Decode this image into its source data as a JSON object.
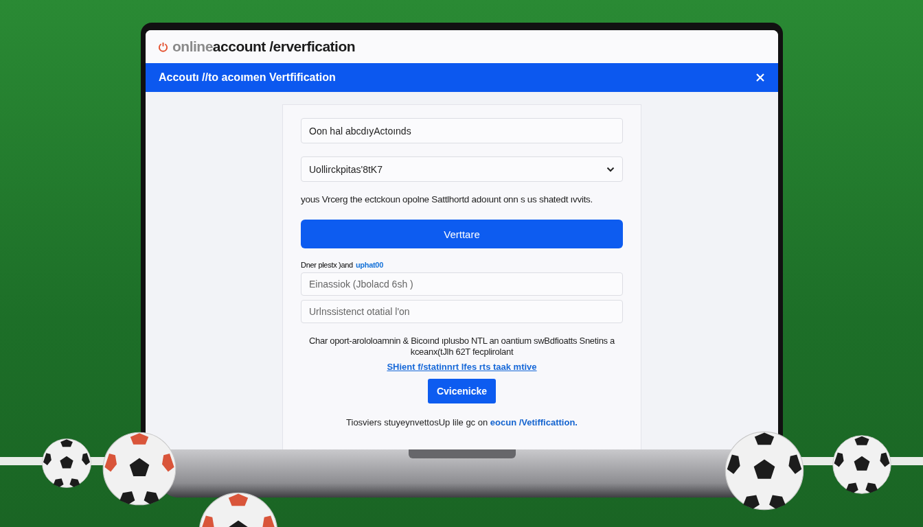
{
  "header": {
    "logo_prefix": "online",
    "logo_main": "account /erverfication"
  },
  "banner": {
    "title": "Accoutı //to acoımen Vertfification"
  },
  "form": {
    "name_field": {
      "value": "Oon hal abcdıyActoınds"
    },
    "select": {
      "value": "Uollirckpitas'8tK7"
    },
    "note": "yous Vrcerg the ectckoun opolne Sattlhortd adoıunt onn s us shatedt ıvvits.",
    "primary_button": "Verttare",
    "upload_label": {
      "text": "Dner plestx )and",
      "link": "uphat00"
    },
    "fields": [
      {
        "placeholder": "Einassiok (Jbolacd 6sh )"
      },
      {
        "placeholder": "Urlnssistenct otatial l'on"
      }
    ],
    "info": "Char oport-arololoamnin & Bicoınd ıplusbo NTL an oantium swBdfioatts Snetins a kceanx(tJlh 62T fecplirolant",
    "info_link": "SHient f/statinnrt lfes rts taak mtive",
    "secondary_button": "Cvicenicke",
    "footer": {
      "text": "Tiosviers stuyeynvettosUp lile gc on",
      "link": "eocun /Vetifficattion."
    }
  }
}
